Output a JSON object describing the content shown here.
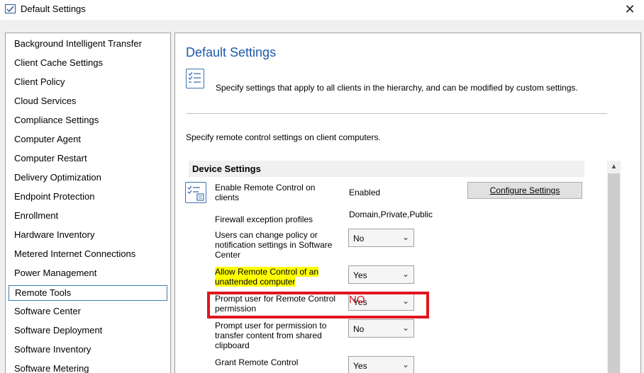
{
  "window": {
    "title": "Default Settings",
    "close_glyph": "✕"
  },
  "nav": {
    "items": [
      "Background Intelligent Transfer",
      "Client Cache Settings",
      "Client Policy",
      "Cloud Services",
      "Compliance Settings",
      "Computer Agent",
      "Computer Restart",
      "Delivery Optimization",
      "Endpoint Protection",
      "Enrollment",
      "Hardware Inventory",
      "Metered Internet Connections",
      "Power Management",
      "Remote Tools",
      "Software Center",
      "Software Deployment",
      "Software Inventory",
      "Software Metering"
    ],
    "selected": "Remote Tools"
  },
  "main": {
    "heading": "Default Settings",
    "description": "Specify settings that apply to all clients in the hierarchy, and can be modified by custom settings.",
    "section_intro": "Specify remote control settings on client computers.",
    "device_settings_header": "Device Settings",
    "enable_remote_control": {
      "label": "Enable Remote Control on clients",
      "value": "Enabled",
      "button": "Configure Settings"
    },
    "firewall": {
      "label": "Firewall exception profiles",
      "value": "Domain,Private,Public"
    },
    "users_change_policy": {
      "label": "Users can change policy or notification settings in Software Center",
      "value": "No"
    },
    "allow_unattended": {
      "label": "Allow Remote Control of an unattended computer",
      "value": "Yes"
    },
    "prompt_permission": {
      "label": "Prompt user for Remote Control permission",
      "value": "Yes",
      "overlay_text": "NO"
    },
    "prompt_clipboard": {
      "label": "Prompt user for permission to transfer content from shared clipboard",
      "value": "No"
    },
    "grant_remote": {
      "label": "Grant Remote Control",
      "value": "Yes"
    }
  },
  "icons": {
    "chevron": "chevron-down-icon",
    "scroll_up": "scroll-up-arrow-icon"
  },
  "colors": {
    "heading": "#1e5aa8",
    "annotation_red": "#e0171f",
    "highlight_yellow": "#ffff00"
  }
}
